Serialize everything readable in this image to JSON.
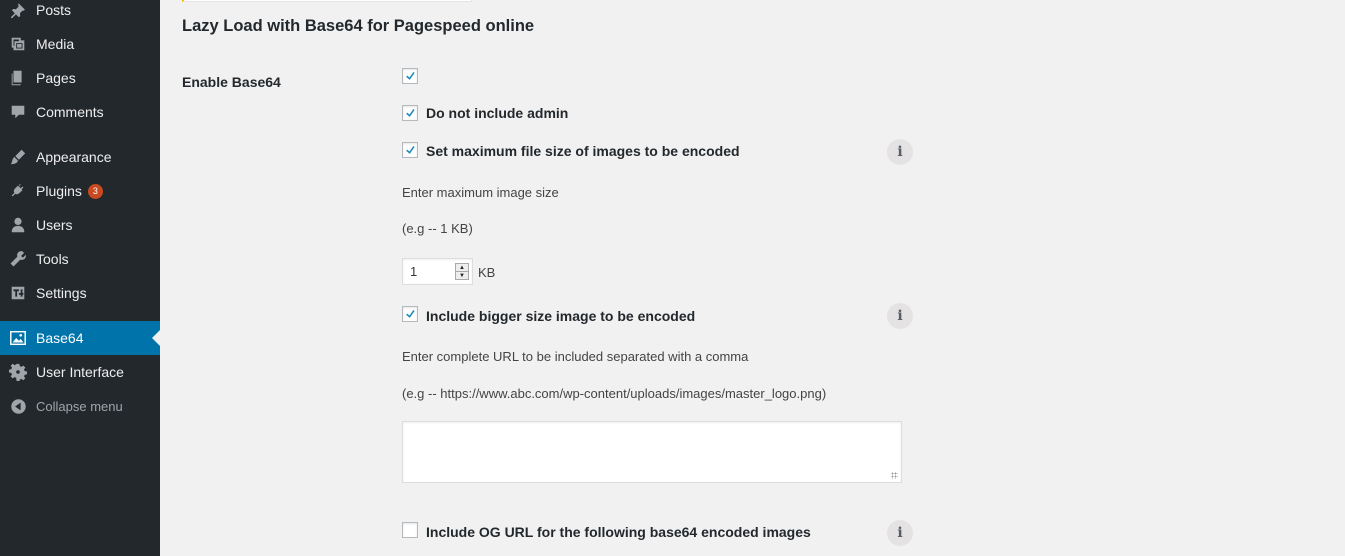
{
  "sidebar": {
    "items": [
      {
        "label": "Posts",
        "icon": "pushpin-icon"
      },
      {
        "label": "Media",
        "icon": "media-icon"
      },
      {
        "label": "Pages",
        "icon": "pages-icon"
      },
      {
        "label": "Comments",
        "icon": "comments-icon"
      },
      {
        "label": "Appearance",
        "icon": "paintbrush-icon"
      },
      {
        "label": "Plugins",
        "icon": "plug-icon",
        "badge": "3"
      },
      {
        "label": "Users",
        "icon": "users-icon"
      },
      {
        "label": "Tools",
        "icon": "wrench-icon"
      },
      {
        "label": "Settings",
        "icon": "settings-icon"
      },
      {
        "label": "Base64",
        "icon": "image-icon",
        "current": true
      },
      {
        "label": "User Interface",
        "icon": "gear-icon"
      }
    ],
    "collapse_label": "Collapse menu"
  },
  "main": {
    "title": "Lazy Load with Base64 for Pagespeed online",
    "field_label": "Enable Base64",
    "options": {
      "enable_checked": true,
      "no_admin": {
        "label": "Do not include admin",
        "checked": true
      },
      "max_size": {
        "label": "Set maximum file size of images to be encoded",
        "checked": true
      },
      "max_size_desc": "Enter maximum image size",
      "max_size_example": "(e.g -- 1 KB)",
      "max_size_value": "1",
      "max_size_unit": "KB",
      "bigger": {
        "label": "Include bigger size image to be encoded",
        "checked": true
      },
      "bigger_desc": "Enter complete URL to be included separated with a comma",
      "bigger_example": "(e.g -- https://www.abc.com/wp-content/uploads/images/master_logo.png)",
      "bigger_value": "",
      "og": {
        "label": "Include OG URL for the following base64 encoded images",
        "checked": false
      },
      "info_glyph": "i"
    }
  },
  "colors": {
    "sidebar_bg": "#23282d",
    "current_bg": "#0073aa",
    "badge_bg": "#ca4a1f",
    "checkmark": "#1e8cbe",
    "page_bg": "#f1f1f1"
  }
}
